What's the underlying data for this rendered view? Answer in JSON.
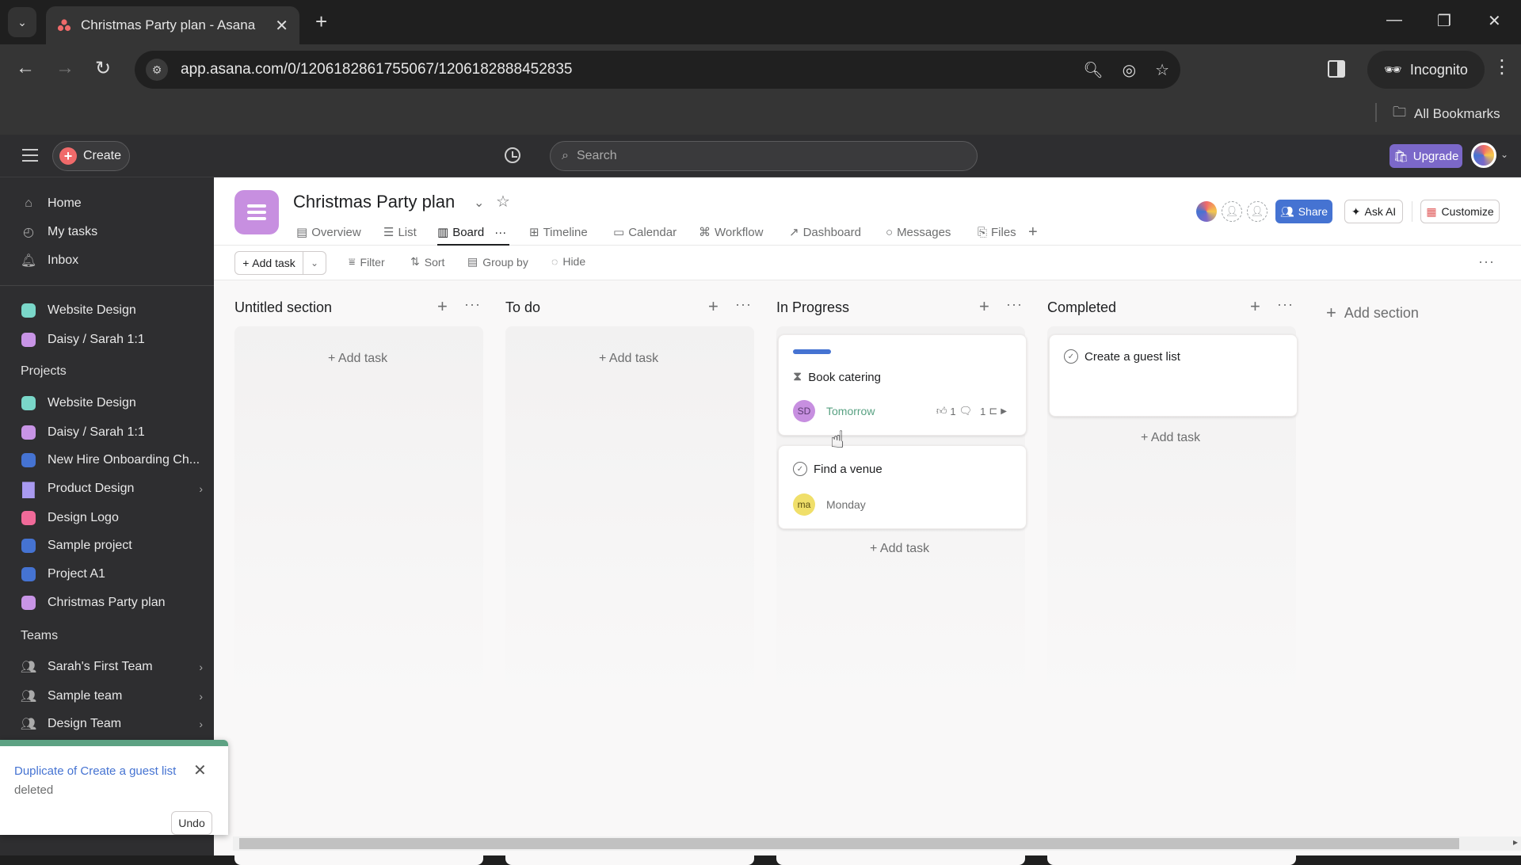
{
  "browser": {
    "tab_title": "Christmas Party plan - Asana",
    "url": "app.asana.com/0/1206182861755067/1206182888452835",
    "incognito_label": "Incognito",
    "bookmarks_label": "All Bookmarks"
  },
  "topbar": {
    "create_label": "Create",
    "search_placeholder": "Search",
    "upgrade_label": "Upgrade"
  },
  "sidebar": {
    "nav": [
      {
        "label": "Home",
        "icon": "home-icon"
      },
      {
        "label": "My tasks",
        "icon": "check-circle-icon"
      },
      {
        "label": "Inbox",
        "icon": "bell-icon"
      }
    ],
    "favorites": [
      {
        "label": "Website Design",
        "color": "#7ad7c9"
      },
      {
        "label": "Daisy / Sarah 1:1",
        "color": "#c894e6",
        "locked": true
      }
    ],
    "projects_heading": "Projects",
    "projects": [
      {
        "label": "Website Design",
        "color": "#7ad7c9"
      },
      {
        "label": "Daisy / Sarah 1:1",
        "color": "#c894e6",
        "locked": true
      },
      {
        "label": "New Hire Onboarding Ch...",
        "color": "#4573d2"
      },
      {
        "label": "Product Design",
        "color": "#a99af0",
        "folder": true
      },
      {
        "label": "Design Logo",
        "color": "#f06a99"
      },
      {
        "label": "Sample project",
        "color": "#4573d2"
      },
      {
        "label": "Project A1",
        "color": "#4573d2"
      },
      {
        "label": "Christmas Party plan",
        "color": "#c894e6"
      }
    ],
    "teams_heading": "Teams",
    "teams": [
      {
        "label": "Sarah's First Team"
      },
      {
        "label": "Sample team"
      },
      {
        "label": "Design Team"
      }
    ]
  },
  "toast": {
    "link_text": "Duplicate of Create a guest list",
    "message": "deleted",
    "undo_label": "Undo"
  },
  "project": {
    "title": "Christmas Party plan",
    "tabs": [
      {
        "label": "Overview",
        "icon": "▤"
      },
      {
        "label": "List",
        "icon": "☰"
      },
      {
        "label": "Board",
        "icon": "▥",
        "active": true
      },
      {
        "label": "Timeline",
        "icon": "⊞"
      },
      {
        "label": "Calendar",
        "icon": "▭"
      },
      {
        "label": "Workflow",
        "icon": "⌘"
      },
      {
        "label": "Dashboard",
        "icon": "↗"
      },
      {
        "label": "Messages",
        "icon": "○"
      },
      {
        "label": "Files",
        "icon": "⎘"
      }
    ],
    "share_label": "Share",
    "ask_ai_label": "Ask AI",
    "customize_label": "Customize"
  },
  "actions": {
    "add_task_label": "Add task",
    "filter_label": "Filter",
    "sort_label": "Sort",
    "group_by_label": "Group by",
    "hide_label": "Hide"
  },
  "board": {
    "add_task_label": "+ Add task",
    "add_section_label": "Add section",
    "columns": [
      {
        "title": "Untitled section",
        "tasks": []
      },
      {
        "title": "To do",
        "tasks": []
      },
      {
        "title": "In Progress",
        "tasks": [
          {
            "name": "Book catering",
            "status_icon": "hourglass",
            "assignee_initials": "SD",
            "assignee_color": "#c78fe0",
            "due": "Tomorrow",
            "due_color": "#58a182",
            "likes": "1",
            "comments": "1",
            "subtasks": "1",
            "progress_bar_color": "#4573d2"
          },
          {
            "name": "Find a venue",
            "status_icon": "check",
            "assignee_initials": "ma",
            "assignee_color": "#f0df6a",
            "due": "Monday",
            "due_color": "#6d6e6f"
          }
        ]
      },
      {
        "title": "Completed",
        "tasks": [
          {
            "name": "Create a guest list",
            "status_icon": "check"
          }
        ]
      }
    ]
  }
}
